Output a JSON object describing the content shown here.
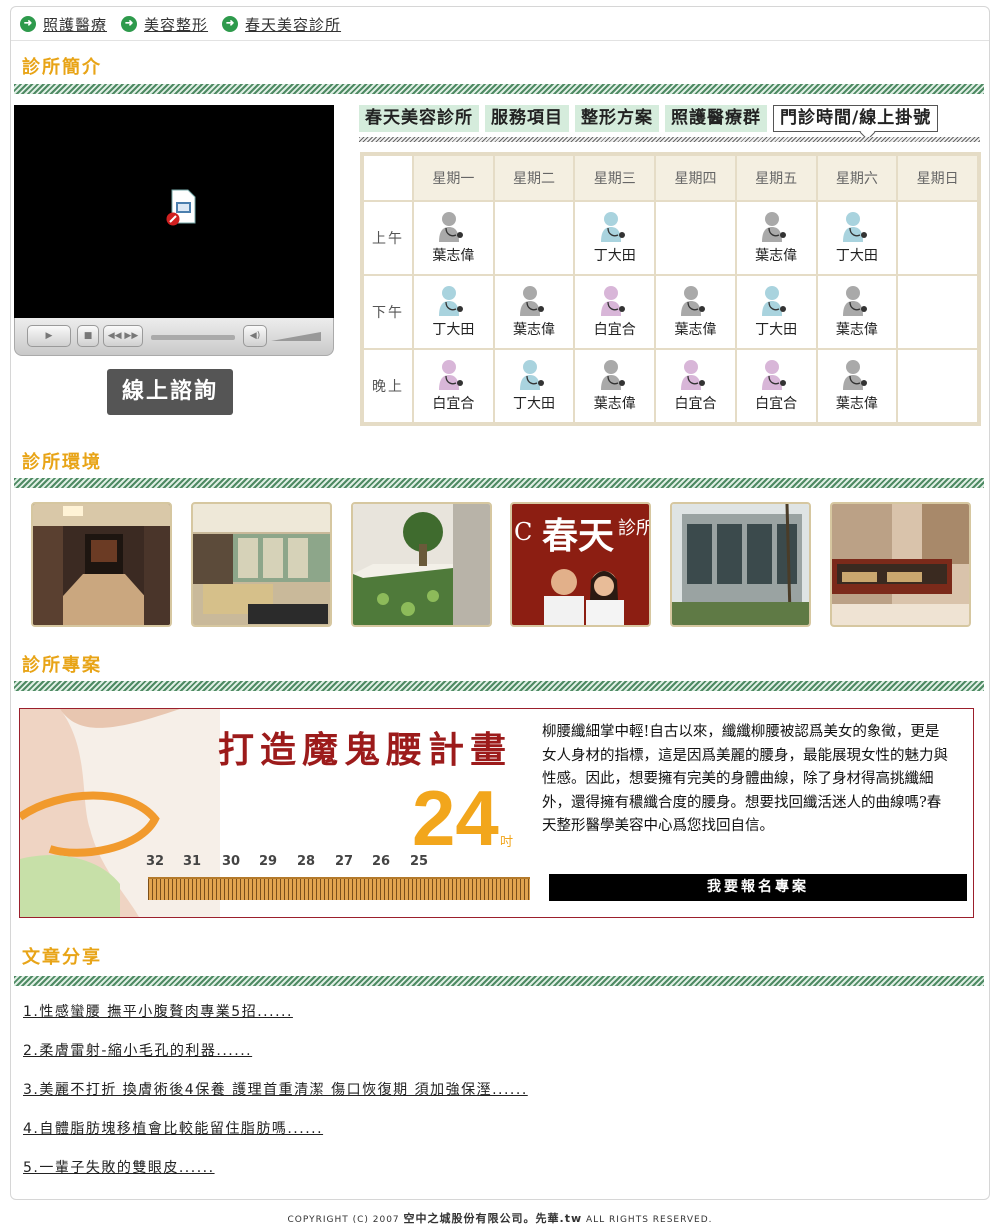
{
  "breadcrumb": [
    "照護醫療",
    "美容整形",
    "春天美容診所"
  ],
  "sections": {
    "intro": "診所簡介",
    "environment": "診所環境",
    "projects": "診所專案",
    "articles": "文章分享"
  },
  "consult_button": "線上諮詢",
  "tabs": [
    "春天美容診所",
    "服務項目",
    "整形方案",
    "照護醫療群",
    "門診時間/線上掛號"
  ],
  "schedule": {
    "days": [
      "星期一",
      "星期二",
      "星期三",
      "星期四",
      "星期五",
      "星期六",
      "星期日"
    ],
    "periods": [
      {
        "label": "上午",
        "doctors": [
          "葉志偉",
          "",
          "丁大田",
          "",
          "葉志偉",
          "丁大田",
          ""
        ]
      },
      {
        "label": "下午",
        "doctors": [
          "丁大田",
          "葉志偉",
          "白宜合",
          "葉志偉",
          "丁大田",
          "葉志偉",
          ""
        ]
      },
      {
        "label": "晚上",
        "doctors": [
          "白宜合",
          "丁大田",
          "葉志偉",
          "白宜合",
          "白宜合",
          "葉志偉",
          ""
        ]
      }
    ],
    "doctor_colors": {
      "葉志偉": "#a9a9a9",
      "丁大田": "#a9d3de",
      "白宜合": "#d8b6d8"
    }
  },
  "project": {
    "title": "打造魔鬼腰計畫",
    "number": "24",
    "unit": "吋",
    "ruler": [
      "32",
      "31",
      "30",
      "29",
      "28",
      "27",
      "26",
      "25"
    ],
    "text": "柳腰纖細掌中輕!自古以來，纖纖柳腰被認爲美女的象徵，更是女人身材的指標，這是因爲美麗的腰身，最能展現女性的魅力與性感。因此，想要擁有完美的身體曲線，除了身材得高挑纖細外，還得擁有穠纖合度的腰身。想要找回纖活迷人的曲線嗎?春天整形醫學美容中心爲您找回自信。",
    "button": "我要報名專案"
  },
  "articles": [
    "1.性感蠻腰 撫平小腹贅肉專業5招......",
    "2.柔膚雷射-縮小毛孔的利器......",
    "3.美麗不打折 換膚術後4保養 護理首重清潔 傷口恢復期 須加強保溼......",
    "4.自體脂肪塊移植會比較能留住脂肪嗎......",
    "5.一輩子失敗的雙眼皮......"
  ],
  "footer": {
    "prefix": "COPYRIGHT (C) 2007 ",
    "company": "空中之城股份有限公司。先華.tw",
    "suffix": " ALL RIGHTS RESERVED."
  },
  "photo_signs": {
    "sign_char": "春天",
    "sign_suffix": "診所",
    "sign_c": "C"
  }
}
